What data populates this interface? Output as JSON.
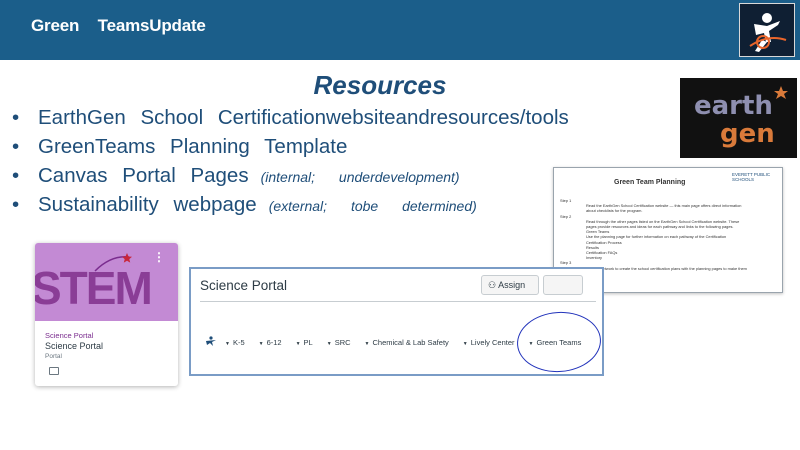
{
  "header": {
    "title": "Green TeamsUpdate"
  },
  "logos": {
    "corner_icon": "figure-with-globe-icon",
    "earthgen_logo": "earthgen-logo-icon"
  },
  "slide": {
    "title": "Resources",
    "bullets": [
      {
        "text": "EarthGen School Certificationwebsiteandresources/tools",
        "note": ""
      },
      {
        "text": "GreenTeams Planning Template",
        "note": ""
      },
      {
        "text": "Canvas Portal Pages",
        "note": "(internal; underdevelopment)"
      },
      {
        "text": "Sustainability webpage",
        "note": "(external; tobe determined)"
      }
    ]
  },
  "doc_thumbnail": {
    "title": "Green Team Planning",
    "brand": "EVERETT PUBLIC SCHOOLS"
  },
  "stem_card": {
    "image_text": "STEM",
    "menu": "⋮",
    "course_label": "Science Portal",
    "course_name": "Science Portal",
    "course_sub": "Portal"
  },
  "portal": {
    "title": "Science Portal",
    "assign_label": "Assign",
    "nav_items": [
      "K-5",
      "6-12",
      "PL",
      "SRC",
      "Chemical & Lab Safety",
      "Lively Center",
      "Green Teams"
    ]
  },
  "colors": {
    "header_bg": "#1b5e8a",
    "text_blue": "#1f4e79",
    "circle": "#2233bb",
    "stem_purple": "#c38ad4"
  }
}
